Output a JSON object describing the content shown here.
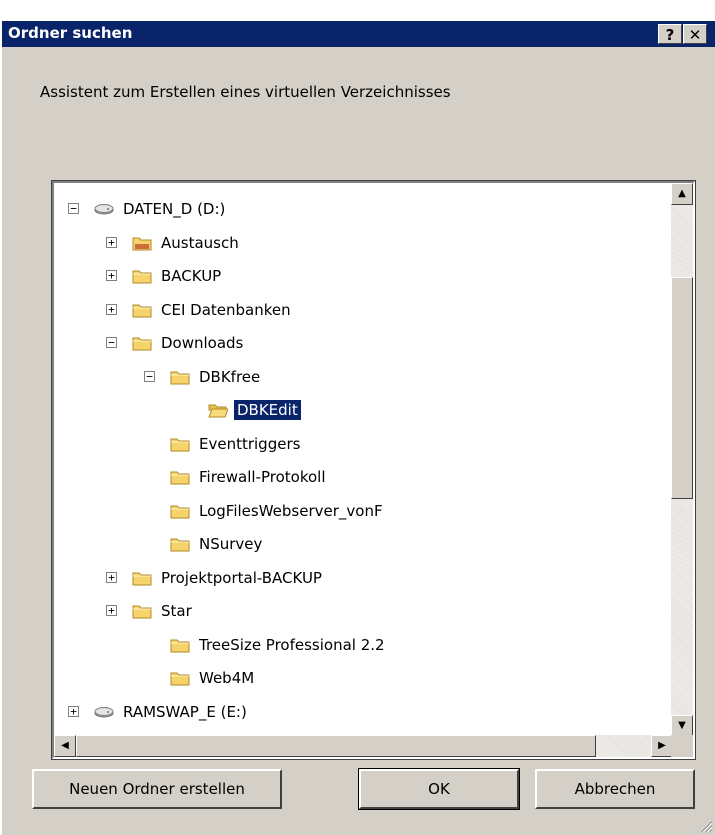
{
  "window": {
    "title": "Ordner suchen",
    "help_glyph": "?",
    "close_glyph": "✕"
  },
  "description": "Assistent zum Erstellen eines virtuellen Verzeichnisses",
  "tree": {
    "nodes": [
      {
        "label": "DATEN_D (D:)",
        "expander": "−",
        "icon": "drive-icon"
      },
      {
        "label": "Austausch",
        "expander": "+",
        "icon": "shared-folder-icon"
      },
      {
        "label": "BACKUP",
        "expander": "+",
        "icon": "folder-icon"
      },
      {
        "label": "CEI Datenbanken",
        "expander": "+",
        "icon": "folder-icon"
      },
      {
        "label": "Downloads",
        "expander": "−",
        "icon": "folder-icon"
      },
      {
        "label": "DBKfree",
        "expander": "−",
        "icon": "folder-icon"
      },
      {
        "label": "DBKEdit",
        "expander": "",
        "icon": "open-folder-icon",
        "selected": true
      },
      {
        "label": "Eventtriggers",
        "expander": "",
        "icon": "folder-icon"
      },
      {
        "label": "Firewall-Protokoll",
        "expander": "",
        "icon": "folder-icon"
      },
      {
        "label": "LogFilesWebserver_vonF",
        "expander": "",
        "icon": "folder-icon"
      },
      {
        "label": "NSurvey",
        "expander": "",
        "icon": "folder-icon"
      },
      {
        "label": "Projektportal-BACKUP",
        "expander": "+",
        "icon": "folder-icon"
      },
      {
        "label": "Star",
        "expander": "+",
        "icon": "folder-icon"
      },
      {
        "label": "TreeSize Professional 2.2",
        "expander": "",
        "icon": "folder-icon"
      },
      {
        "label": "Web4M",
        "expander": "",
        "icon": "folder-icon"
      },
      {
        "label": "RAMSWAP_E (E:)",
        "expander": "+",
        "icon": "drive-icon"
      }
    ],
    "scroll_up_glyph": "▲",
    "scroll_down_glyph": "▼",
    "scroll_left_glyph": "◀",
    "scroll_right_glyph": "▶"
  },
  "buttons": {
    "new_folder": "Neuen Ordner erstellen",
    "ok": "OK",
    "cancel": "Abbrechen"
  },
  "colors": {
    "titlebar": "#0a246a",
    "face": "#d4d0c8",
    "selection": "#0a246a",
    "folder": "#f6d46b"
  }
}
